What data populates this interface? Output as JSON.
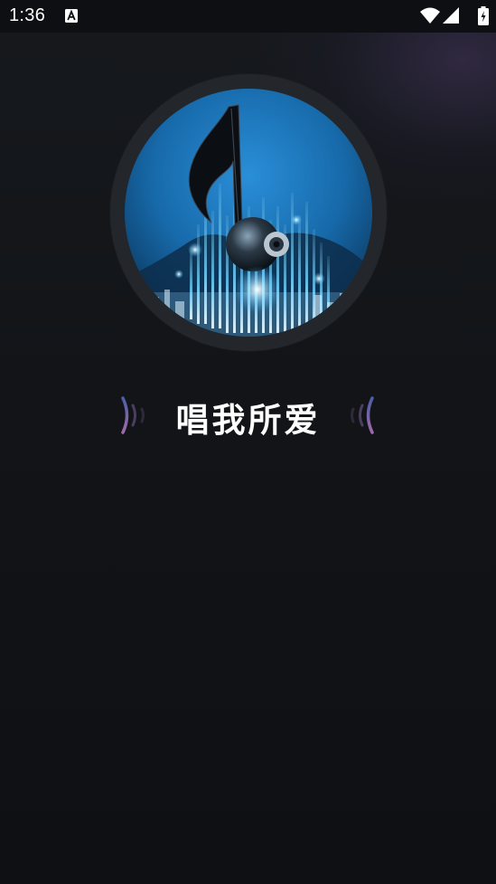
{
  "status_bar": {
    "time": "1:36",
    "notification_icon": "a-accessibility-icon",
    "icons": [
      "wifi-icon",
      "signal-icon",
      "battery-charging-icon"
    ]
  },
  "app": {
    "logo_icon": "music-note-equalizer-logo",
    "title": "唱我所爱",
    "decoration_icons": [
      "sound-wave-left-icon",
      "sound-wave-right-icon"
    ]
  },
  "colors": {
    "background": "#121418",
    "status_bar": "#0d0f12",
    "ring": "#23262b",
    "logo_blue": "#1e7bd0",
    "wave_purple": "#7a5c9a",
    "title": "#ffffff"
  }
}
